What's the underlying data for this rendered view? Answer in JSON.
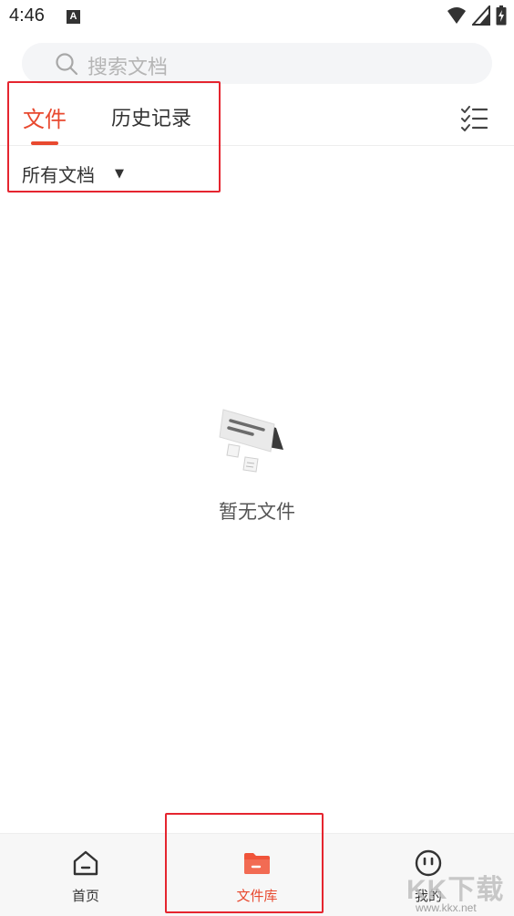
{
  "status_bar": {
    "time": "4:46",
    "notification_glyph": "A",
    "icons": [
      "wifi-icon",
      "signal-icon",
      "battery-icon"
    ]
  },
  "search": {
    "placeholder": "搜索文档"
  },
  "tabs": [
    {
      "label": "文件",
      "active": true
    },
    {
      "label": "历史记录",
      "active": false
    }
  ],
  "filter": {
    "selected": "所有文档"
  },
  "empty_state": {
    "message": "暂无文件"
  },
  "bottom_nav": [
    {
      "label": "首页",
      "icon": "home-icon",
      "active": false
    },
    {
      "label": "文件库",
      "icon": "folder-icon",
      "active": true
    },
    {
      "label": "我的",
      "icon": "profile-face-icon",
      "active": false
    }
  ],
  "watermark": {
    "brand": "KK下载",
    "url": "www.kkx.net"
  },
  "colors": {
    "accent": "#e8492f",
    "highlight_box": "#e5252f",
    "search_bg": "#f4f5f7",
    "nav_bg": "#f7f7f7"
  }
}
